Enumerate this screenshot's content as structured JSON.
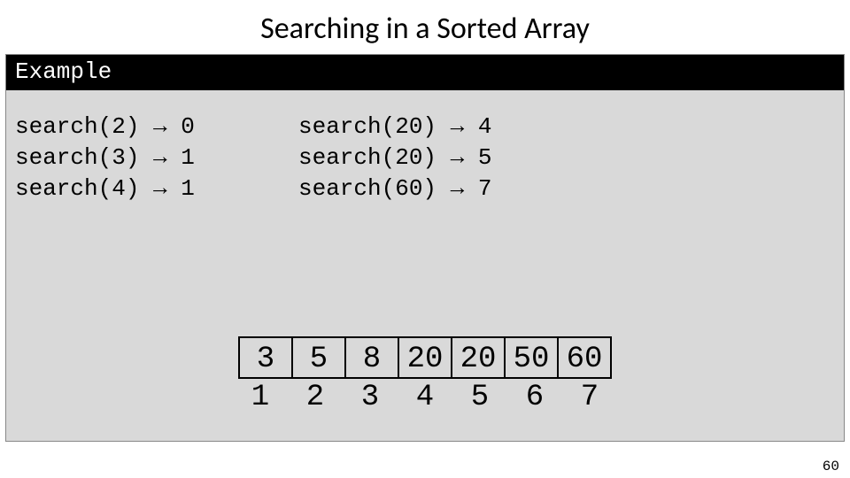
{
  "title": "Searching in a Sorted Array",
  "example_label": "Example",
  "code_left": "search(2) → 0\nsearch(3) → 1\nsearch(4) → 1",
  "code_right": "search(20) → 4\nsearch(20) → 5\nsearch(60) → 7",
  "array_values": [
    "3",
    "5",
    "8",
    "20",
    "20",
    "50",
    "60"
  ],
  "array_indices": [
    "1",
    "2",
    "3",
    "4",
    "5",
    "6",
    "7"
  ],
  "page_number": "60"
}
